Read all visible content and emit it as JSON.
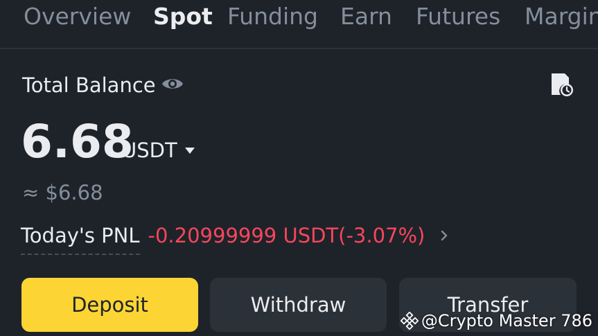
{
  "tabs": [
    {
      "label": "Overview",
      "active": false
    },
    {
      "label": "Spot",
      "active": true
    },
    {
      "label": "Funding",
      "active": false
    },
    {
      "label": "Earn",
      "active": false
    },
    {
      "label": "Futures",
      "active": false
    },
    {
      "label": "Margin",
      "active": false
    }
  ],
  "balance": {
    "label": "Total Balance",
    "value": "6.68",
    "currency": "USDT",
    "fiat_equivalent": "≈ $6.68"
  },
  "pnl": {
    "label": "Today's PNL",
    "value": "-0.20999999 USDT(-3.07%)"
  },
  "actions": {
    "deposit": "Deposit",
    "withdraw": "Withdraw",
    "transfer": "Transfer"
  },
  "watermark": {
    "text": "@Crypto Master 786"
  },
  "icons": {
    "visibility": "eye-icon",
    "history": "history-icon",
    "currency_dropdown": "caret-down-icon",
    "pnl_details": "chevron-right-icon",
    "brand": "binance-logo-icon"
  },
  "colors": {
    "background": "#1e2329",
    "primary": "#fcd535",
    "negative": "#f6465d",
    "secondary_button": "#2b3139",
    "muted_text": "#848e9c"
  }
}
